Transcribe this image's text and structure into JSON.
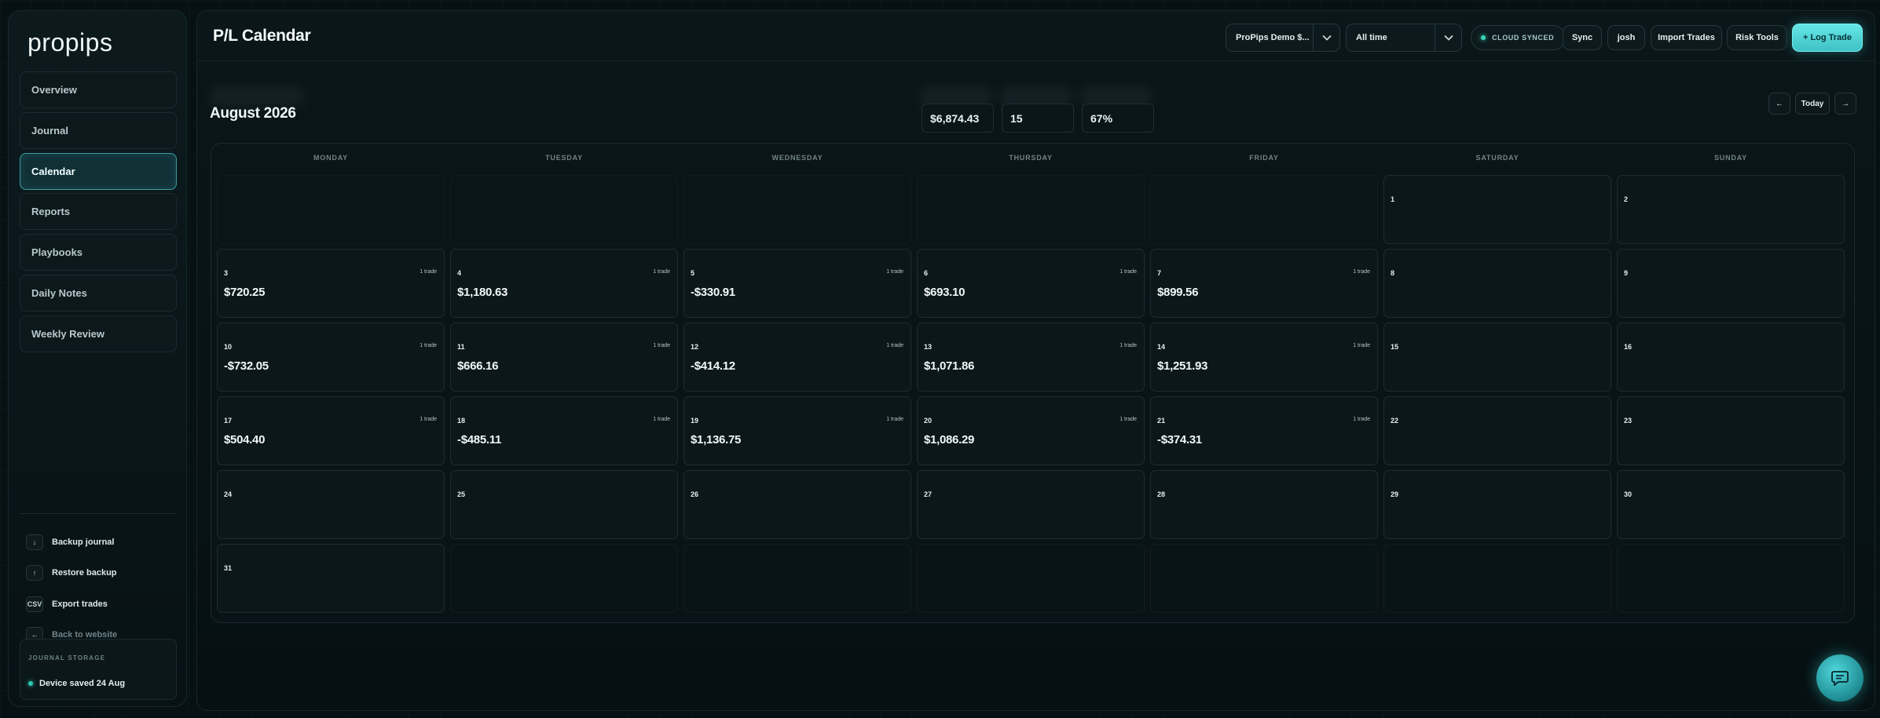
{
  "app": {
    "logo": "propips"
  },
  "sidebar": {
    "nav": [
      {
        "label": "Overview",
        "active": false
      },
      {
        "label": "Journal",
        "active": false
      },
      {
        "label": "Calendar",
        "active": true
      },
      {
        "label": "Reports",
        "active": false
      },
      {
        "label": "Playbooks",
        "active": false
      },
      {
        "label": "Daily Notes",
        "active": false
      },
      {
        "label": "Weekly Review",
        "active": false
      }
    ],
    "actions": [
      {
        "icon": "↓",
        "label": "Backup journal"
      },
      {
        "icon": "↑",
        "label": "Restore backup"
      },
      {
        "icon": "CSV",
        "label": "Export trades"
      },
      {
        "icon": "←",
        "label": "Back to website"
      }
    ],
    "storage": {
      "label": "JOURNAL STORAGE",
      "status": "Device saved 24 Aug"
    }
  },
  "header": {
    "title": "P/L Calendar",
    "account_select": "ProPips Demo $...",
    "range_select": "All time",
    "cloud_status": "CLOUD SYNCED",
    "buttons": {
      "sync": "Sync",
      "user": "josh",
      "import": "Import Trades",
      "risk": "Risk Tools",
      "log": "+ Log Trade"
    }
  },
  "calendar": {
    "month": "August 2026",
    "stats": {
      "pnl": "$6,874.43",
      "trades": "15",
      "win_rate": "67%"
    },
    "nav": {
      "prev": "←",
      "today": "Today",
      "next": "→"
    },
    "weekdays": [
      "MONDAY",
      "TUESDAY",
      "WEDNESDAY",
      "THURSDAY",
      "FRIDAY",
      "SATURDAY",
      "SUNDAY"
    ],
    "days": [
      {
        "day": "1",
        "trades": "",
        "pnl": ""
      },
      {
        "day": "2",
        "trades": "",
        "pnl": ""
      },
      {
        "day": "3",
        "trades": "1 trade",
        "pnl": "$720.25"
      },
      {
        "day": "4",
        "trades": "1 trade",
        "pnl": "$1,180.63"
      },
      {
        "day": "5",
        "trades": "1 trade",
        "pnl": "-$330.91"
      },
      {
        "day": "6",
        "trades": "1 trade",
        "pnl": "$693.10"
      },
      {
        "day": "7",
        "trades": "1 trade",
        "pnl": "$899.56"
      },
      {
        "day": "8",
        "trades": "",
        "pnl": ""
      },
      {
        "day": "9",
        "trades": "",
        "pnl": ""
      },
      {
        "day": "10",
        "trades": "1 trade",
        "pnl": "-$732.05"
      },
      {
        "day": "11",
        "trades": "1 trade",
        "pnl": "$666.16"
      },
      {
        "day": "12",
        "trades": "1 trade",
        "pnl": "-$414.12"
      },
      {
        "day": "13",
        "trades": "1 trade",
        "pnl": "$1,071.86"
      },
      {
        "day": "14",
        "trades": "1 trade",
        "pnl": "$1,251.93"
      },
      {
        "day": "15",
        "trades": "",
        "pnl": ""
      },
      {
        "day": "16",
        "trades": "",
        "pnl": ""
      },
      {
        "day": "17",
        "trades": "1 trade",
        "pnl": "$504.40"
      },
      {
        "day": "18",
        "trades": "1 trade",
        "pnl": "-$485.11"
      },
      {
        "day": "19",
        "trades": "1 trade",
        "pnl": "$1,136.75"
      },
      {
        "day": "20",
        "trades": "1 trade",
        "pnl": "$1,086.29"
      },
      {
        "day": "21",
        "trades": "1 trade",
        "pnl": "-$374.31"
      },
      {
        "day": "22",
        "trades": "",
        "pnl": ""
      },
      {
        "day": "23",
        "trades": "",
        "pnl": ""
      },
      {
        "day": "24",
        "trades": "",
        "pnl": ""
      },
      {
        "day": "25",
        "trades": "",
        "pnl": ""
      },
      {
        "day": "26",
        "trades": "",
        "pnl": ""
      },
      {
        "day": "27",
        "trades": "",
        "pnl": ""
      },
      {
        "day": "28",
        "trades": "",
        "pnl": ""
      },
      {
        "day": "29",
        "trades": "",
        "pnl": ""
      },
      {
        "day": "30",
        "trades": "",
        "pnl": ""
      },
      {
        "day": "31",
        "trades": "",
        "pnl": ""
      }
    ]
  },
  "chat": {
    "icon": "chat-bubble-icon"
  }
}
